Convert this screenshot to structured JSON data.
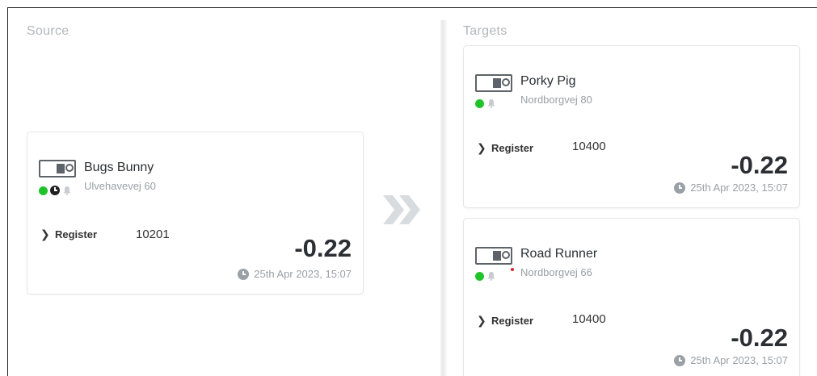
{
  "source": {
    "title": "Source",
    "device": {
      "name": "Bugs Bunny",
      "address": "Ulvehavevej 60",
      "register_label": "Register",
      "register_number": "10201",
      "value": "-0.22",
      "timestamp": "25th Apr 2023, 15:07"
    }
  },
  "targets": {
    "title": "Targets",
    "devices": [
      {
        "name": "Porky Pig",
        "address": "Nordborgvej 80",
        "register_label": "Register",
        "register_number": "10400",
        "value": "-0.22",
        "timestamp": "25th Apr 2023, 15:07"
      },
      {
        "name": "Road Runner",
        "address": "Nordborgvej 66",
        "register_label": "Register",
        "register_number": "10400",
        "value": "-0.22",
        "timestamp": "25th Apr 2023, 15:07"
      }
    ]
  },
  "icons": {
    "toggle": "toggle-switch-icon",
    "online": "green-status-dot-icon",
    "schedule": "clock-icon",
    "alarm": "bell-icon",
    "expand": "chevron-right-icon",
    "transfer": "double-chevron-right-icon",
    "time": "clock-icon"
  },
  "colors": {
    "online": "#21c32b",
    "alert": "#e0202b",
    "muted": "#9aa0a5",
    "title": "#b3b7bb"
  }
}
